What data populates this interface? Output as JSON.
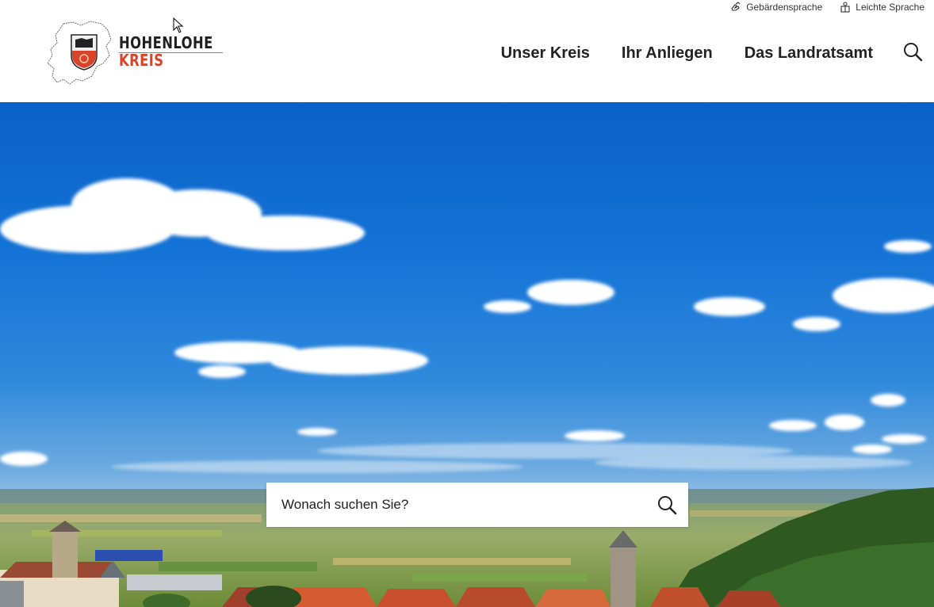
{
  "meta": {
    "sign_language_label": "Gebärdensprache",
    "easy_language_label": "Leichte Sprache"
  },
  "logo": {
    "line1": "HOHENLOHE",
    "line2": "KREIS"
  },
  "nav": {
    "items": [
      {
        "label": "Unser Kreis"
      },
      {
        "label": "Ihr Anliegen"
      },
      {
        "label": "Das Landratsamt"
      }
    ]
  },
  "search": {
    "placeholder": "Wonach suchen Sie?"
  },
  "icons": {
    "sign_language": "hands-icon",
    "easy_language": "easy-language-icon",
    "search": "search-icon",
    "search_submit": "search-icon"
  },
  "colors": {
    "brand_red": "#d8432a",
    "text": "#222222",
    "sky": "#1473d6"
  }
}
